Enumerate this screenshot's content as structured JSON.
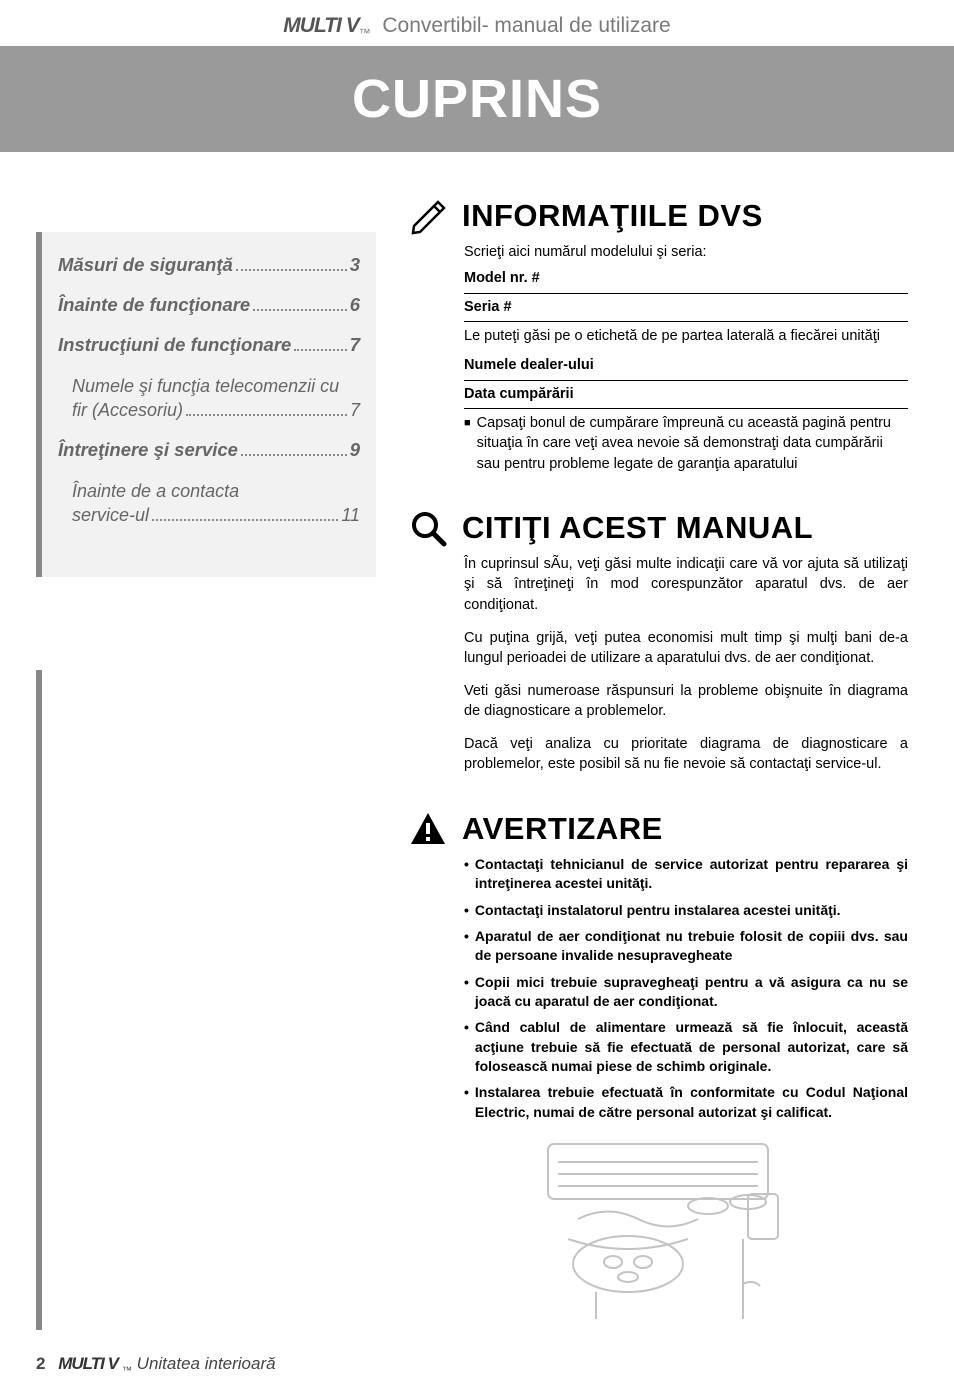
{
  "header": {
    "logo": "MULTI V",
    "subtitle": "Convertibil- manual de utilizare"
  },
  "title": "CUPRINS",
  "toc": {
    "items": [
      {
        "label": "Măsuri de siguranţă",
        "page": "3",
        "bold": true
      },
      {
        "label": "Înainte de funcţionare",
        "page": "6",
        "bold": true
      },
      {
        "label": "Instrucţiuni de funcţionare",
        "page": "7",
        "bold": true
      },
      {
        "label_line1": "Numele şi funcţia telecomenzii cu",
        "label_line2": "fir (Accesoriu)",
        "page": "7",
        "bold": false
      },
      {
        "label": "Întreţinere şi service",
        "page": "9",
        "bold": true
      },
      {
        "label_line1": "Înainte de a contacta",
        "label_line2": "service-ul",
        "page": "11",
        "bold": false
      }
    ]
  },
  "info": {
    "heading": "INFORMAŢIILE DVS",
    "intro": "Scrieţi aici numărul modelului şi seria:",
    "model_label": "Model nr. #",
    "serial_label": "Seria #",
    "find_note": "Le puteţi găsi pe o etichetă de pe partea laterală a fiecărei unităţi",
    "dealer_label": "Numele dealer-ului",
    "date_label": "Data cumpărării",
    "receipt_note": "Capsaţi bonul de cumpărare împreună cu această pagină pentru situaţia în care veţi avea nevoie să demonstraţi data cumpărării sau pentru probleme legate de garanţia aparatului"
  },
  "manual": {
    "heading": "CITIŢI ACEST MANUAL",
    "p1": "În cuprinsul sÃu, veţi găsi multe indicaţii care vă vor ajuta să utilizaţi şi să întreţineţi în mod corespunzător aparatul dvs. de aer condiţionat.",
    "p2": "Cu puţina grijă, veţi putea economisi mult timp şi mulţi bani de-a lungul perioadei de utilizare a aparatului dvs. de aer condiţionat.",
    "p3": "Veti găsi numeroase răspunsuri la probleme obişnuite în diagrama de diagnosticare a problemelor.",
    "p4": "Dacă veţi analiza cu prioritate diagrama de diagnosticare a problemelor, este posibil să nu fie nevoie să contactaţi service-ul."
  },
  "warning": {
    "heading": "AVERTIZARE",
    "items": [
      "Contactaţi tehnicianul de service autorizat pentru repararea şi intreţinerea acestei unităţi.",
      "Contactaţi instalatorul pentru instalarea acestei unităţi.",
      "Aparatul de aer condiţionat nu trebuie folosit de copiii dvs. sau de persoane invalide nesupravegheate",
      "Copii mici trebuie supravegheaţi pentru a vă asigura ca nu se joacă cu aparatul de aer condiţionat.",
      "Când cablul de alimentare urmează să fie înlocuit, această acţiune trebuie să fie efectuată de personal autorizat, care să folosească numai piese de schimb originale.",
      "Instalarea trebuie efectuată în conformitate cu Codul Naţional Electric, numai de către personal autorizat şi calificat."
    ]
  },
  "footer": {
    "page": "2",
    "logo": "MULTI V",
    "text": "Unitatea interioară"
  }
}
